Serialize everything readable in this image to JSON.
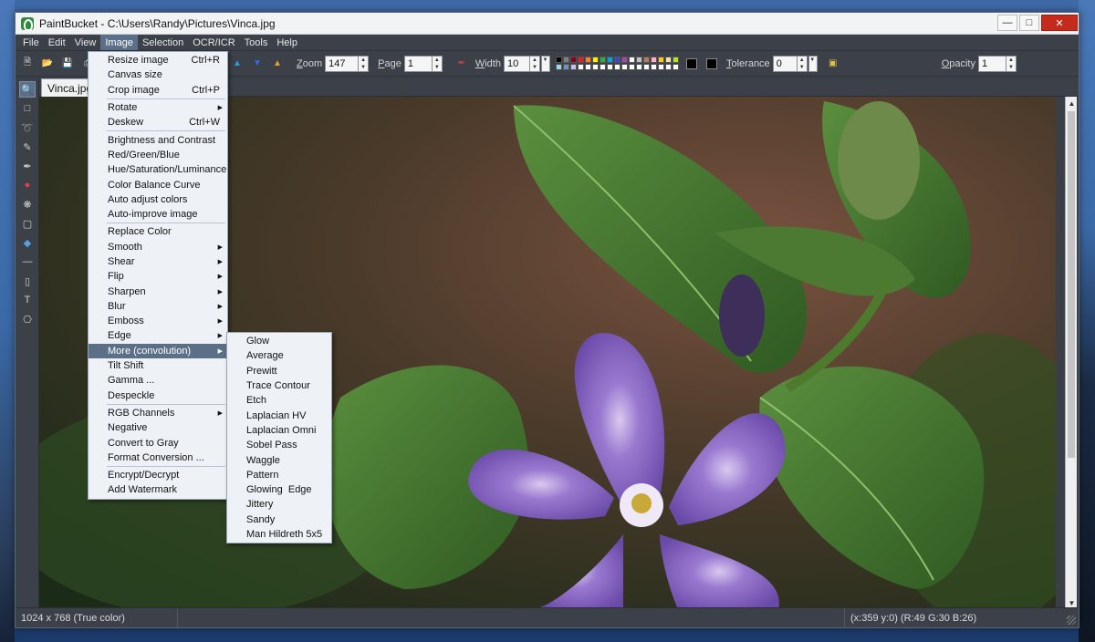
{
  "window": {
    "title": "PaintBucket - C:\\Users\\Randy\\Pictures\\Vinca.jpg"
  },
  "menubar": [
    "File",
    "Edit",
    "View",
    "Image",
    "Selection",
    "OCR/ICR",
    "Tools",
    "Help"
  ],
  "toolbar": {
    "zoom_label": "Zoom",
    "zoom_value": "147",
    "page_label": "Page",
    "page_value": "1",
    "width_label": "Width",
    "width_value": "10",
    "tolerance_label": "Tolerance",
    "tolerance_value": "0",
    "opacity_label": "Opacity",
    "opacity_value": "1",
    "palette_colors": [
      "#000000",
      "#7f7f7f",
      "#880015",
      "#ed1c24",
      "#ff7f27",
      "#fff200",
      "#22b14c",
      "#00a2e8",
      "#3f48cc",
      "#a349a4",
      "#ffffff",
      "#c3c3c3",
      "#b97a57",
      "#ffaec9",
      "#ffc90e",
      "#efe4b0",
      "#b5e61d",
      "#99d9ea",
      "#7092be",
      "#c8bfe7",
      "#ffffff",
      "#ffffff",
      "#ffffff",
      "#ffffff",
      "#ffffff",
      "#ffffff",
      "#ffffff",
      "#ffffff",
      "#ffffff",
      "#ffffff",
      "#ffffff",
      "#ffffff",
      "#ffffff",
      "#ffffff"
    ]
  },
  "tab": {
    "label": "Vinca.jpg"
  },
  "image_menu": [
    {
      "label": "Resize image",
      "shortcut": "Ctrl+R"
    },
    {
      "label": "Canvas size"
    },
    {
      "label": "Crop image",
      "shortcut": "Ctrl+P"
    },
    {
      "sep": true
    },
    {
      "label": "Rotate",
      "submenu": true
    },
    {
      "label": "Deskew",
      "shortcut": "Ctrl+W"
    },
    {
      "sep": true
    },
    {
      "label": "Brightness and Contrast"
    },
    {
      "label": "Red/Green/Blue"
    },
    {
      "label": "Hue/Saturation/Luminance"
    },
    {
      "label": "Color Balance Curve"
    },
    {
      "label": "Auto adjust colors"
    },
    {
      "label": "Auto-improve image"
    },
    {
      "sep": true
    },
    {
      "label": "Replace Color"
    },
    {
      "label": "Smooth",
      "submenu": true
    },
    {
      "label": "Shear",
      "submenu": true
    },
    {
      "label": "Flip",
      "submenu": true
    },
    {
      "label": "Sharpen",
      "submenu": true
    },
    {
      "label": "Blur",
      "submenu": true
    },
    {
      "label": "Emboss",
      "submenu": true
    },
    {
      "label": "Edge",
      "submenu": true
    },
    {
      "label": "More (convolution)",
      "submenu": true,
      "highlight": true
    },
    {
      "label": "Tilt Shift"
    },
    {
      "label": "Gamma ..."
    },
    {
      "label": "Despeckle"
    },
    {
      "sep": true
    },
    {
      "label": "RGB Channels",
      "submenu": true
    },
    {
      "label": "Negative"
    },
    {
      "label": "Convert to Gray"
    },
    {
      "label": "Format Conversion ..."
    },
    {
      "sep": true
    },
    {
      "label": "Encrypt/Decrypt"
    },
    {
      "label": "Add Watermark"
    }
  ],
  "convolution_menu": [
    "Glow",
    "Average",
    "Prewitt",
    "Trace Contour",
    "Etch",
    "Laplacian HV",
    "Laplacian Omni",
    "Sobel Pass",
    "Waggle",
    "Pattern",
    "Glowing  Edge",
    "Jittery",
    "Sandy",
    "Man Hildreth 5x5"
  ],
  "status": {
    "dimensions": "1024 x 768  (True color)",
    "cursor": "(x:359  y:0)  (R:49 G:30 B:26)"
  }
}
